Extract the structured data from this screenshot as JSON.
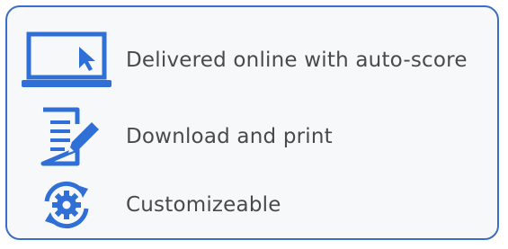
{
  "features": [
    {
      "label": "Delivered online with auto-score",
      "icon": "laptop-cursor-icon"
    },
    {
      "label": "Download and print",
      "icon": "document-pencil-icon"
    },
    {
      "label": "Customizeable",
      "icon": "gear-refresh-icon"
    }
  ],
  "colors": {
    "accent": "#2f6fd6",
    "border": "#3a6ec9",
    "text": "#4a4a4a",
    "background": "#f7f8f9"
  }
}
